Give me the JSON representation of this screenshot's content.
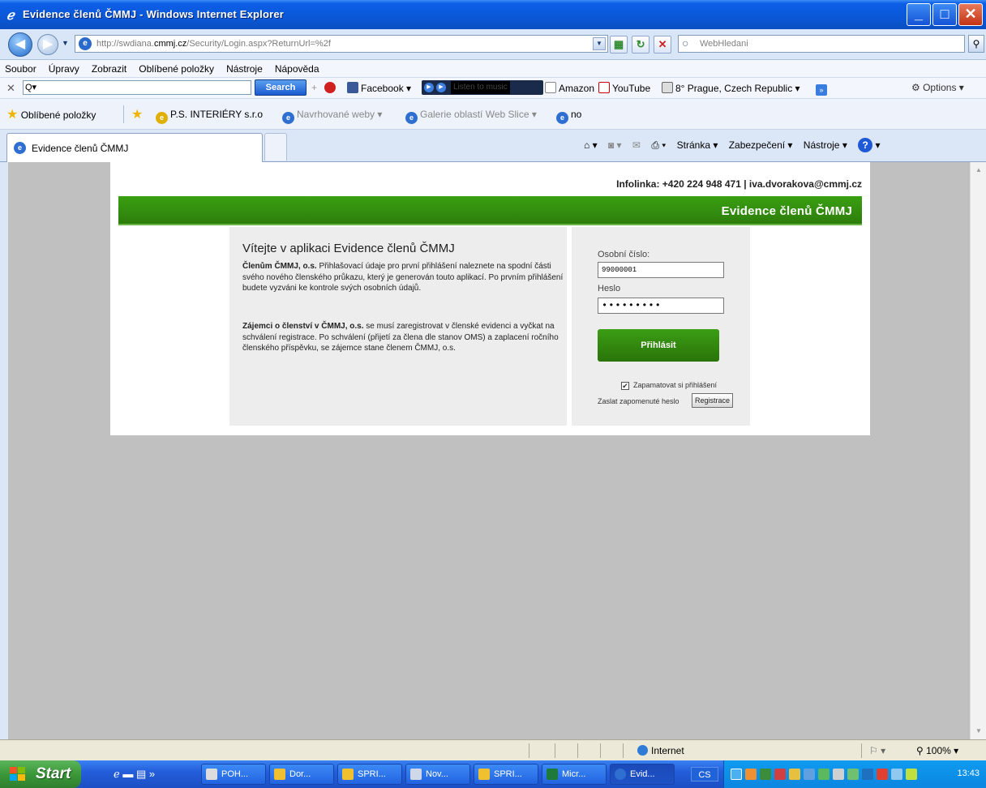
{
  "window": {
    "title": "Evidence členů ČMMJ - Windows Internet Explorer",
    "minimize": "_",
    "maximize": "□",
    "close": "✕"
  },
  "address": {
    "url_prefix": "http://swdiana.",
    "url_host": "cmmj.cz",
    "url_path": "/Security/Login.aspx?ReturnUrl=%2f",
    "search_placeholder": "WebHledani"
  },
  "menu": [
    "Soubor",
    "Úpravy",
    "Zobrazit",
    "Oblíbené položky",
    "Nástroje",
    "Nápověda"
  ],
  "toolbar1": {
    "query": "Q▾",
    "search_label": "Search",
    "facebook": "Facebook ▾",
    "listen": "Listen to music",
    "amazon": "Amazon",
    "youtube": "YouTube",
    "weather": "8° Prague, Czech Republic ▾",
    "options": "Options ▾"
  },
  "favorites": {
    "label": "Oblíbené položky",
    "items": [
      "P.S. INTERIÉRY s.r.o",
      "Navrhované weby ▾",
      "Galerie oblastí Web Slice ▾",
      "no"
    ]
  },
  "tab": {
    "title": "Evidence členů ČMMJ"
  },
  "commands": {
    "page": "Stránka ▾",
    "security": "Zabezpečení ▾",
    "tools": "Nástroje ▾"
  },
  "page": {
    "infoline": "Infolinka: +420 224 948 471 | iva.dvorakova@cmmj.cz",
    "banner": "Evidence členů ČMMJ",
    "welcome_title": "Vítejte v aplikaci Evidence členů ČMMJ",
    "p1_bold": "Členům ČMMJ, o.s.",
    "p1_text": " Přihlašovací údaje pro první přihlášení naleznete na spodní části svého nového členského průkazu, který je generován touto aplikací. Po prvním přihlášení budete vyzváni ke kontrole svých osobních údajů.",
    "p2_bold": "Zájemci o členství v ČMMJ, o.s.",
    "p2_text": " se musí zaregistrovat v členské evidenci a vyčkat na schválení registrace. Po schválení (přijetí za člena dle stanov OMS) a zaplacení ročního členského příspěvku, se zájemce stane členem ČMMJ, o.s."
  },
  "login": {
    "personal_label": "Osobní číslo:",
    "personal_value": "99000001",
    "password_label": "Heslo",
    "password_value": "•••••••••",
    "login_button": "Přihlásit",
    "remember_label": "Zapamatovat si přihlášení",
    "remember_checked": "✔",
    "forgot_label": "Zaslat zapomenuté heslo",
    "register_button": "Registrace"
  },
  "status": {
    "zone": "Internet",
    "zoom": "100%"
  },
  "taskbar": {
    "start": "Start",
    "tasks": [
      "POH...",
      "Dor...",
      "SPRI...",
      "Nov...",
      "SPRI...",
      "Micr...",
      "Evid..."
    ],
    "lang": "CS",
    "clock": "13:43"
  },
  "colors": {
    "banner_green": "#2d8a0e",
    "xp_blue": "#0a58d8"
  }
}
